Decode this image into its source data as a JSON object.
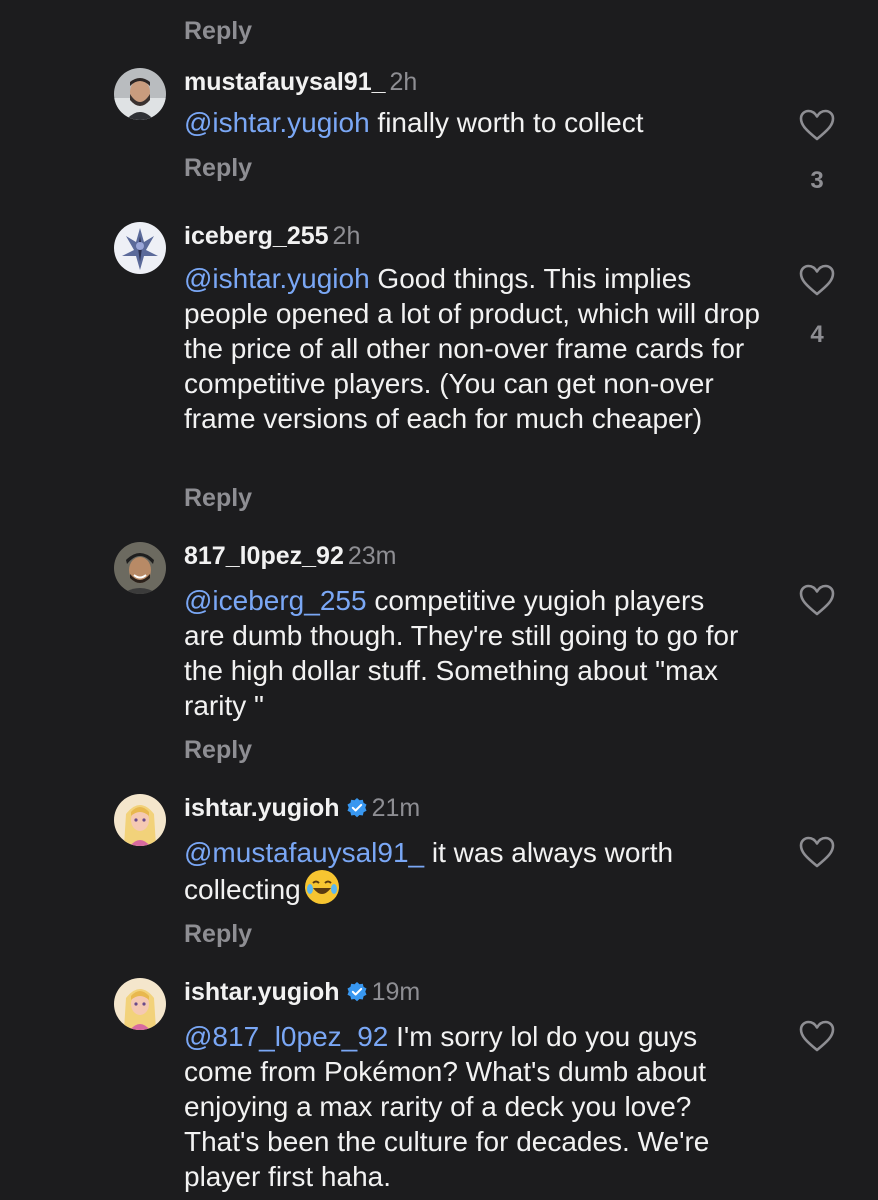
{
  "top_reply": "Reply",
  "comments": [
    {
      "username": "mustafauysal91_",
      "time": "2h",
      "mention": "@ishtar.yugioh",
      "text": " finally worth to collect",
      "reply": "Reply",
      "likes": "3",
      "avatar": "avatar-man-beard"
    },
    {
      "username": "iceberg_255",
      "time": "2h",
      "mention": "@ishtar.yugioh",
      "text": " Good things. This implies people opened a lot of product, which will drop the price of all other non-over frame cards for competitive players. (You can get non-over frame versions of each for much cheaper)",
      "reply": "Reply",
      "likes": "4",
      "avatar": "avatar-anime-character"
    },
    {
      "username": "817_l0pez_92",
      "time": "23m",
      "mention": "@iceberg_255",
      "text": " competitive yugioh players are dumb though. They're still going to go for the high dollar stuff. Something about \"max rarity \"",
      "reply": "Reply",
      "avatar": "avatar-man-cap"
    },
    {
      "username": "ishtar.yugioh",
      "time": "21m",
      "verified": true,
      "mention": "@mustafauysal91_",
      "text": " it was always worth collecting",
      "emoji": "laughing-tears-emoji",
      "reply": "Reply",
      "avatar": "avatar-cartoon-woman"
    },
    {
      "username": "ishtar.yugioh",
      "time": "19m",
      "verified": true,
      "mention": "@817_l0pez_92",
      "text": " I'm sorry lol do you guys come from Pokémon? What's dumb about enjoying a max rarity of a deck you love? That's been the culture for decades. We're player first haha.",
      "avatar": "avatar-cartoon-woman"
    }
  ],
  "colors": {
    "background": "#1c1c1e",
    "mention": "#7aa7f5",
    "secondary": "#8e8e93",
    "verified": "#3897f0"
  }
}
